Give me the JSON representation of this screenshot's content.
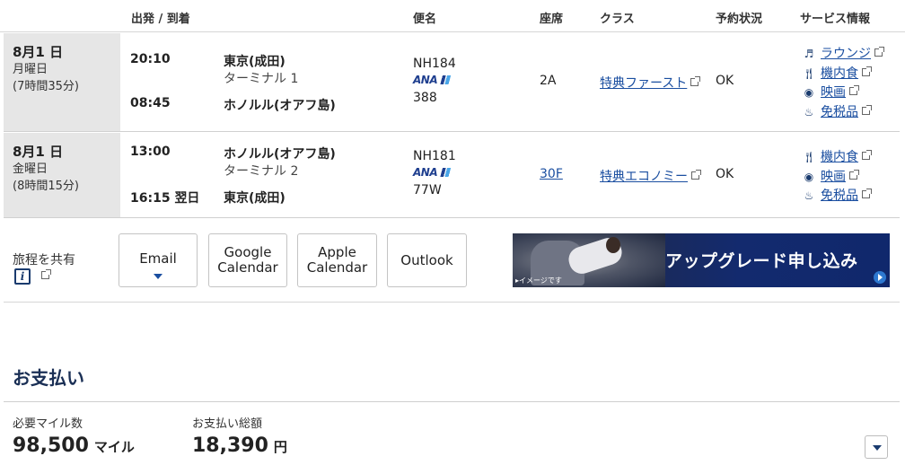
{
  "header": {
    "departure_arrival": "出発 / 到着",
    "flight_name": "便名",
    "seat": "座席",
    "class": "クラス",
    "reservation_status": "予約状況",
    "service_info": "サービス情報"
  },
  "flights": [
    {
      "date": "8月1 日",
      "weekday": "月曜日",
      "duration": "(7時間35分)",
      "dep_time": "20:10",
      "dep_place": "東京(成田)",
      "dep_terminal": "ターミナル 1",
      "arr_time": "08:45",
      "arr_place": "ホノルル(オアフ島)",
      "flight_no": "NH184",
      "airline_logo": "ANA",
      "aircraft": "388",
      "seat": "2A",
      "class": "特典ファースト",
      "status": "OK",
      "services": [
        {
          "icon": "lounge-icon",
          "label": "ラウンジ"
        },
        {
          "icon": "meal-icon",
          "label": "機内食"
        },
        {
          "icon": "movie-icon",
          "label": "映画"
        },
        {
          "icon": "duty-free-icon",
          "label": "免税品"
        }
      ]
    },
    {
      "date": "8月1 日",
      "weekday": "金曜日",
      "duration": "(8時間15分)",
      "dep_time": "13:00",
      "dep_place": "ホノルル(オアフ島)",
      "dep_terminal": "ターミナル 2",
      "arr_time": "16:15 翌日",
      "arr_place": "東京(成田)",
      "flight_no": "NH181",
      "airline_logo": "ANA",
      "aircraft": "77W",
      "seat": "30F",
      "class": "特典エコノミー",
      "status": "OK",
      "services": [
        {
          "icon": "meal-icon",
          "label": "機内食"
        },
        {
          "icon": "movie-icon",
          "label": "映画"
        },
        {
          "icon": "duty-free-icon",
          "label": "免税品"
        }
      ]
    }
  ],
  "share": {
    "label": "旅程を共有",
    "email": "Email",
    "google_calendar_line1": "Google",
    "google_calendar_line2": "Calendar",
    "apple_calendar_line1": "Apple",
    "apple_calendar_line2": "Calendar",
    "outlook": "Outlook"
  },
  "banner": {
    "title": "アップグレード申し込み",
    "note": "▸イメージです"
  },
  "payment": {
    "title": "お支払い",
    "miles_label": "必要マイル数",
    "miles_value": "98,500",
    "miles_unit": "マイル",
    "total_label": "お支払い総額",
    "total_value": "18,390",
    "total_unit": "円"
  },
  "colors": {
    "link": "#1a4ea0",
    "date_cell_bg": "#e6e6e6",
    "banner_bg": "#132a6e",
    "heading": "#1a2f55"
  }
}
